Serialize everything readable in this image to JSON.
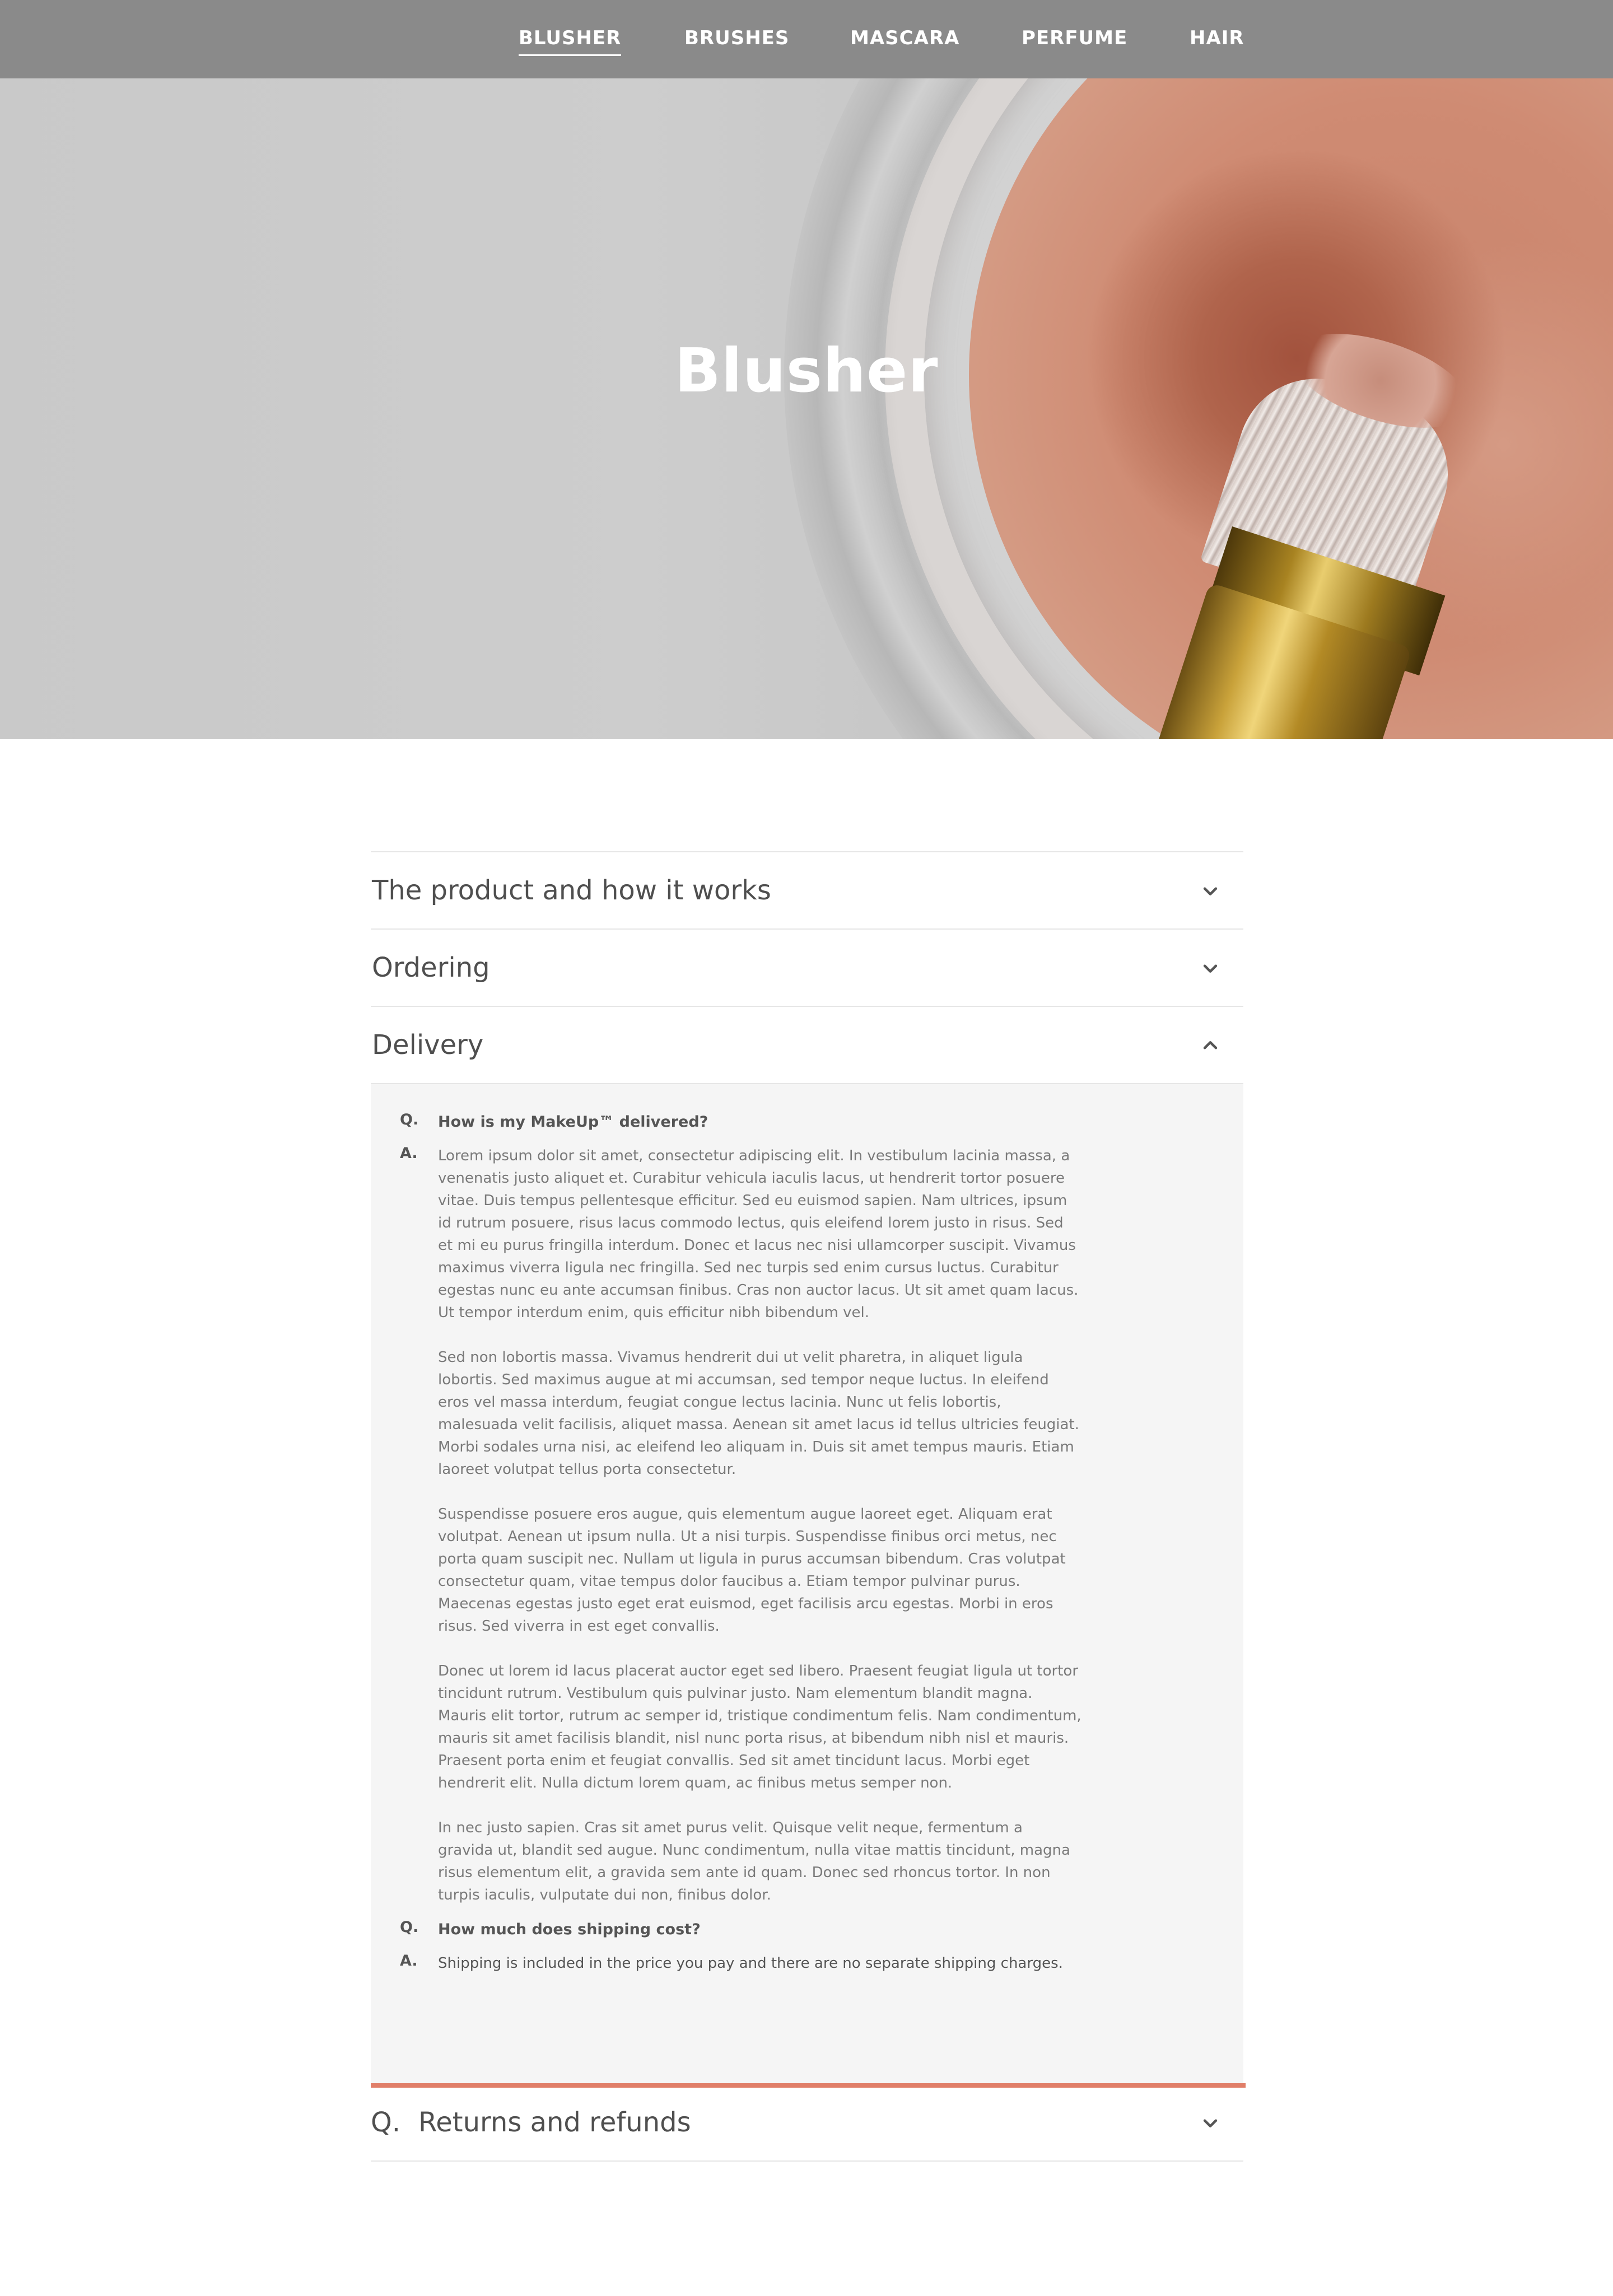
{
  "nav": {
    "items": [
      {
        "label": "BLUSHER",
        "active": true
      },
      {
        "label": "BRUSHES",
        "active": false
      },
      {
        "label": "MASCARA",
        "active": false
      },
      {
        "label": "PERFUME",
        "active": false
      },
      {
        "label": "HAIR",
        "active": false
      }
    ]
  },
  "hero": {
    "title": "Blusher"
  },
  "accordion": {
    "sections": [
      {
        "title": "The product and how it works",
        "expanded": false
      },
      {
        "title": "Ordering",
        "expanded": false
      },
      {
        "title": "Delivery",
        "expanded": true
      },
      {
        "title": "Returns and refunds",
        "expanded": false,
        "prefix": "Q."
      }
    ],
    "q_mark": "Q.",
    "a_mark": "A.",
    "delivery": {
      "qa": [
        {
          "question": "How is my MakeUp™ delivered?",
          "answer": [
            "Lorem ipsum dolor sit amet, consectetur adipiscing elit. In vestibulum lacinia massa, a venenatis justo aliquet et. Curabitur vehicula iaculis lacus, ut hendrerit tortor posuere vitae. Duis tempus pellentesque efficitur. Sed eu euismod sapien. Nam ultrices, ipsum id rutrum posuere, risus lacus commodo lectus, quis eleifend lorem justo in risus. Sed et mi eu purus fringilla interdum. Donec et lacus nec nisi ullamcorper suscipit. Vivamus maximus viverra ligula nec fringilla. Sed nec turpis sed enim cursus luctus. Curabitur egestas nunc eu ante accumsan finibus. Cras non auctor lacus. Ut sit amet quam lacus. Ut tempor interdum enim, quis efficitur nibh bibendum vel.",
            "Sed non lobortis massa. Vivamus hendrerit dui ut velit pharetra, in aliquet ligula lobortis. Sed maximus augue at mi accumsan, sed tempor neque luctus. In eleifend eros vel massa interdum, feugiat congue lectus lacinia. Nunc ut felis lobortis, malesuada velit facilisis, aliquet massa. Aenean sit amet lacus id tellus ultricies feugiat. Morbi sodales urna nisi, ac eleifend leo aliquam in. Duis sit amet tempus mauris. Etiam laoreet volutpat tellus porta consectetur.",
            "Suspendisse posuere eros augue, quis elementum augue laoreet eget. Aliquam erat volutpat. Aenean ut ipsum nulla. Ut a nisi turpis. Suspendisse finibus orci metus, nec porta quam suscipit nec. Nullam ut ligula in purus accumsan bibendum. Cras volutpat consectetur quam, vitae tempus dolor faucibus a. Etiam tempor pulvinar purus. Maecenas egestas justo eget erat euismod, eget facilisis arcu egestas. Morbi in eros risus. Sed viverra in est eget convallis.",
            "Donec ut lorem id lacus placerat auctor eget sed libero. Praesent feugiat ligula ut tortor tincidunt rutrum. Vestibulum quis pulvinar justo. Nam elementum blandit magna. Mauris elit tortor, rutrum ac semper id, tristique condimentum felis. Nam condimentum, mauris sit amet facilisis blandit, nisl nunc porta risus, at bibendum nibh nisl et mauris. Praesent porta enim et feugiat convallis. Sed sit amet tincidunt lacus. Morbi eget hendrerit elit. Nulla dictum lorem quam, ac finibus metus semper non.",
            "In nec justo sapien. Cras sit amet purus velit. Quisque velit neque, fermentum a gravida ut, blandit sed augue. Nunc condimentum, nulla vitae mattis tincidunt, magna risus elementum elit, a gravida sem ante id quam. Donec sed rhoncus tortor. In non turpis iaculis, vulputate dui non, finibus dolor."
          ]
        },
        {
          "question": "How much does shipping cost?",
          "answer": [
            "Shipping is included in the price you pay and there are no separate shipping charges."
          ]
        }
      ]
    }
  },
  "colors": {
    "accent": "#e07e68",
    "nav_bg": "#8a8a8a",
    "panel_bg": "#f5f5f5"
  },
  "icons": {
    "collapsed": "chevron-down-icon",
    "expanded": "chevron-up-icon"
  }
}
